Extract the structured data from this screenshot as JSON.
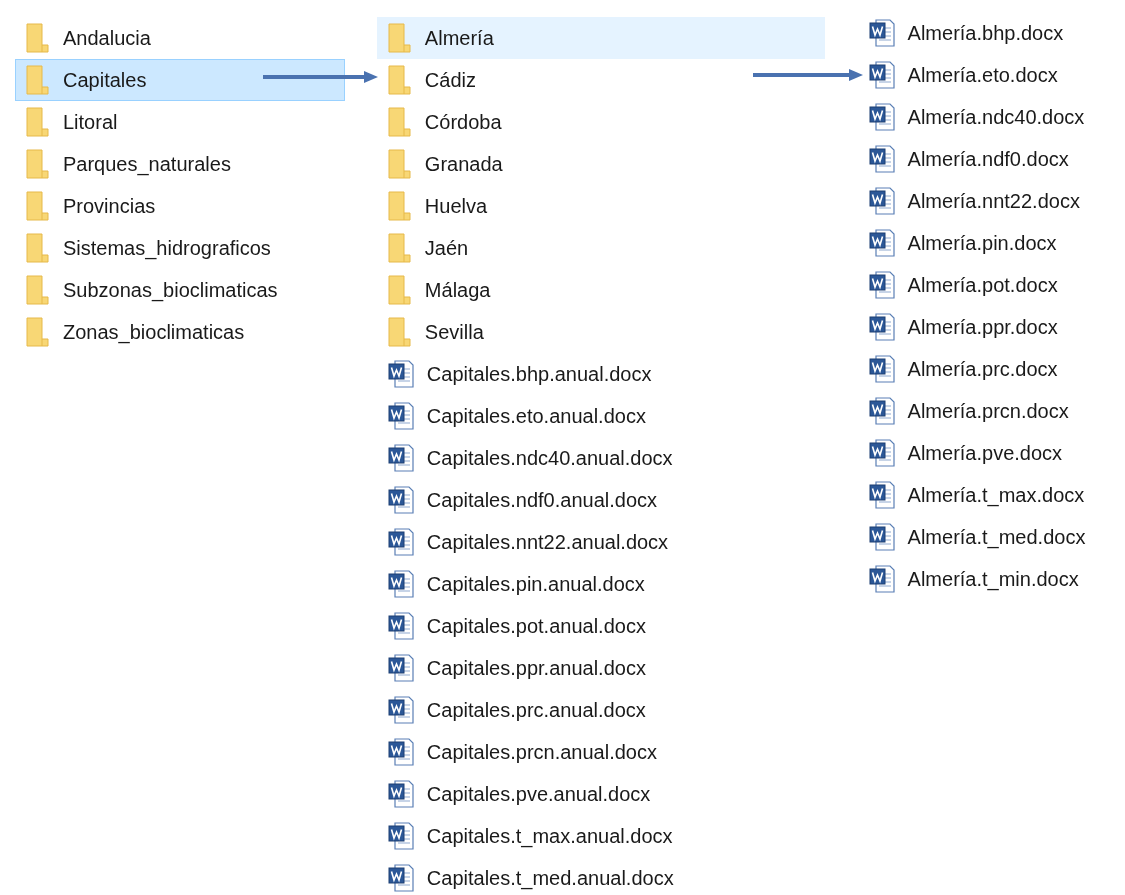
{
  "columns": [
    {
      "items": [
        {
          "kind": "folder",
          "name": "Andalucia",
          "selected": false,
          "hovered": false
        },
        {
          "kind": "folder",
          "name": "Capitales",
          "selected": true,
          "hovered": false
        },
        {
          "kind": "folder",
          "name": "Litoral",
          "selected": false,
          "hovered": false
        },
        {
          "kind": "folder",
          "name": "Parques_naturales",
          "selected": false,
          "hovered": false
        },
        {
          "kind": "folder",
          "name": "Provincias",
          "selected": false,
          "hovered": false
        },
        {
          "kind": "folder",
          "name": "Sistemas_hidrograficos",
          "selected": false,
          "hovered": false
        },
        {
          "kind": "folder",
          "name": "Subzonas_bioclimaticas",
          "selected": false,
          "hovered": false
        },
        {
          "kind": "folder",
          "name": "Zonas_bioclimaticas",
          "selected": false,
          "hovered": false
        }
      ]
    },
    {
      "items": [
        {
          "kind": "folder",
          "name": "Almería",
          "selected": false,
          "hovered": true
        },
        {
          "kind": "folder",
          "name": "Cádiz",
          "selected": false,
          "hovered": false
        },
        {
          "kind": "folder",
          "name": "Córdoba",
          "selected": false,
          "hovered": false
        },
        {
          "kind": "folder",
          "name": "Granada",
          "selected": false,
          "hovered": false
        },
        {
          "kind": "folder",
          "name": "Huelva",
          "selected": false,
          "hovered": false
        },
        {
          "kind": "folder",
          "name": "Jaén",
          "selected": false,
          "hovered": false
        },
        {
          "kind": "folder",
          "name": "Málaga",
          "selected": false,
          "hovered": false
        },
        {
          "kind": "folder",
          "name": "Sevilla",
          "selected": false,
          "hovered": false
        },
        {
          "kind": "docx",
          "name": "Capitales.bhp.anual.docx",
          "selected": false,
          "hovered": false
        },
        {
          "kind": "docx",
          "name": "Capitales.eto.anual.docx",
          "selected": false,
          "hovered": false
        },
        {
          "kind": "docx",
          "name": "Capitales.ndc40.anual.docx",
          "selected": false,
          "hovered": false
        },
        {
          "kind": "docx",
          "name": "Capitales.ndf0.anual.docx",
          "selected": false,
          "hovered": false
        },
        {
          "kind": "docx",
          "name": "Capitales.nnt22.anual.docx",
          "selected": false,
          "hovered": false
        },
        {
          "kind": "docx",
          "name": "Capitales.pin.anual.docx",
          "selected": false,
          "hovered": false
        },
        {
          "kind": "docx",
          "name": "Capitales.pot.anual.docx",
          "selected": false,
          "hovered": false
        },
        {
          "kind": "docx",
          "name": "Capitales.ppr.anual.docx",
          "selected": false,
          "hovered": false
        },
        {
          "kind": "docx",
          "name": "Capitales.prc.anual.docx",
          "selected": false,
          "hovered": false
        },
        {
          "kind": "docx",
          "name": "Capitales.prcn.anual.docx",
          "selected": false,
          "hovered": false
        },
        {
          "kind": "docx",
          "name": "Capitales.pve.anual.docx",
          "selected": false,
          "hovered": false
        },
        {
          "kind": "docx",
          "name": "Capitales.t_max.anual.docx",
          "selected": false,
          "hovered": false
        },
        {
          "kind": "docx",
          "name": "Capitales.t_med.anual.docx",
          "selected": false,
          "hovered": false
        }
      ]
    },
    {
      "items": [
        {
          "kind": "docx",
          "name": "Almería.bhp.docx",
          "selected": false,
          "hovered": false
        },
        {
          "kind": "docx",
          "name": "Almería.eto.docx",
          "selected": false,
          "hovered": false
        },
        {
          "kind": "docx",
          "name": "Almería.ndc40.docx",
          "selected": false,
          "hovered": false
        },
        {
          "kind": "docx",
          "name": "Almería.ndf0.docx",
          "selected": false,
          "hovered": false
        },
        {
          "kind": "docx",
          "name": "Almería.nnt22.docx",
          "selected": false,
          "hovered": false
        },
        {
          "kind": "docx",
          "name": "Almería.pin.docx",
          "selected": false,
          "hovered": false
        },
        {
          "kind": "docx",
          "name": "Almería.pot.docx",
          "selected": false,
          "hovered": false
        },
        {
          "kind": "docx",
          "name": "Almería.ppr.docx",
          "selected": false,
          "hovered": false
        },
        {
          "kind": "docx",
          "name": "Almería.prc.docx",
          "selected": false,
          "hovered": false
        },
        {
          "kind": "docx",
          "name": "Almería.prcn.docx",
          "selected": false,
          "hovered": false
        },
        {
          "kind": "docx",
          "name": "Almería.pve.docx",
          "selected": false,
          "hovered": false
        },
        {
          "kind": "docx",
          "name": "Almería.t_max.docx",
          "selected": false,
          "hovered": false
        },
        {
          "kind": "docx",
          "name": "Almería.t_med.docx",
          "selected": false,
          "hovered": false
        },
        {
          "kind": "docx",
          "name": "Almería.t_min.docx",
          "selected": false,
          "hovered": false
        }
      ]
    }
  ]
}
